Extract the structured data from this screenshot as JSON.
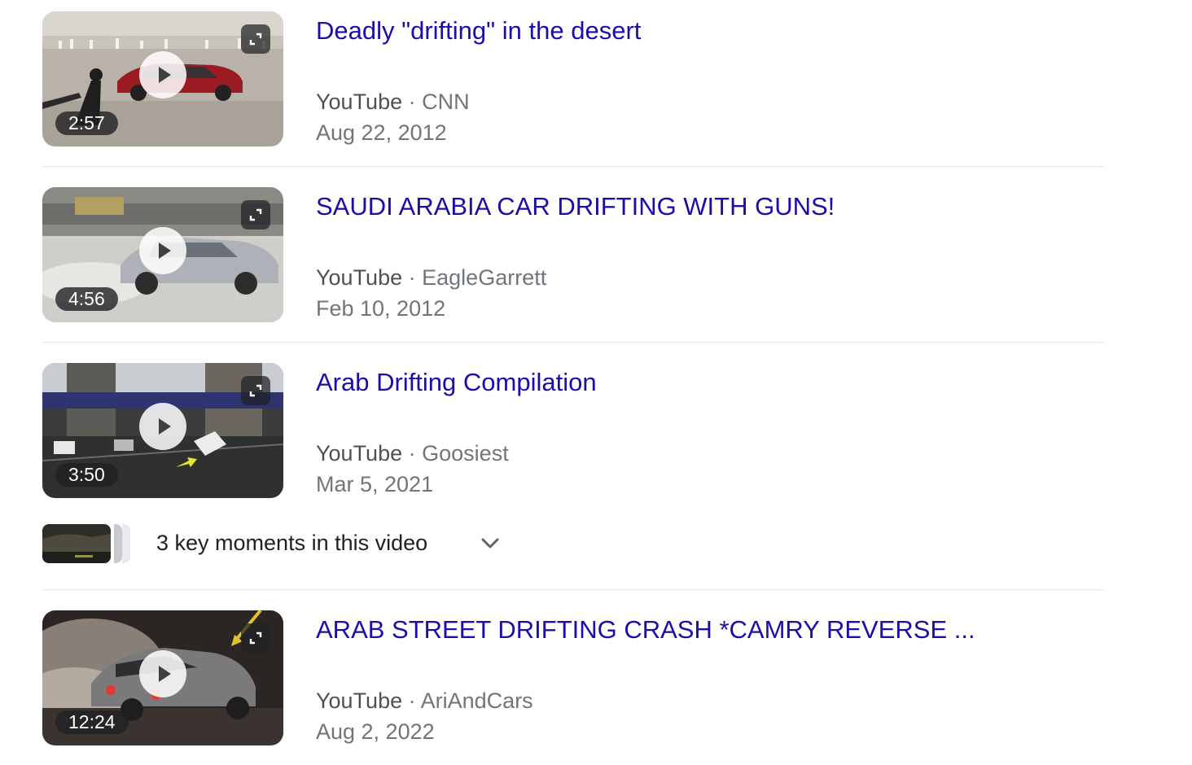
{
  "results": [
    {
      "title": "Deadly \"drifting\" in the desert",
      "source": "YouTube",
      "channel": "CNN",
      "date": "Aug 22, 2012",
      "duration": "2:57"
    },
    {
      "title": "SAUDI ARABIA CAR DRIFTING WITH GUNS!",
      "source": "YouTube",
      "channel": "EagleGarrett",
      "date": "Feb 10, 2012",
      "duration": "4:56"
    },
    {
      "title": "Arab Drifting Compilation",
      "source": "YouTube",
      "channel": "Goosiest",
      "date": "Mar 5, 2021",
      "duration": "3:50"
    },
    {
      "title": "ARAB STREET DRIFTING CRASH *CAMRY REVERSE ...",
      "source": "YouTube",
      "channel": "AriAndCars",
      "date": "Aug 2, 2022",
      "duration": "12:24"
    }
  ],
  "key_moments": {
    "label": "3 key moments in this video"
  },
  "separator": "·",
  "colors": {
    "title_link": "#1a0dab",
    "meta_text": "#70757a",
    "source_text": "#4d5156",
    "divider": "#e3e3e3"
  },
  "icons": [
    "play-icon",
    "expand-icon",
    "chevron-down-icon"
  ]
}
